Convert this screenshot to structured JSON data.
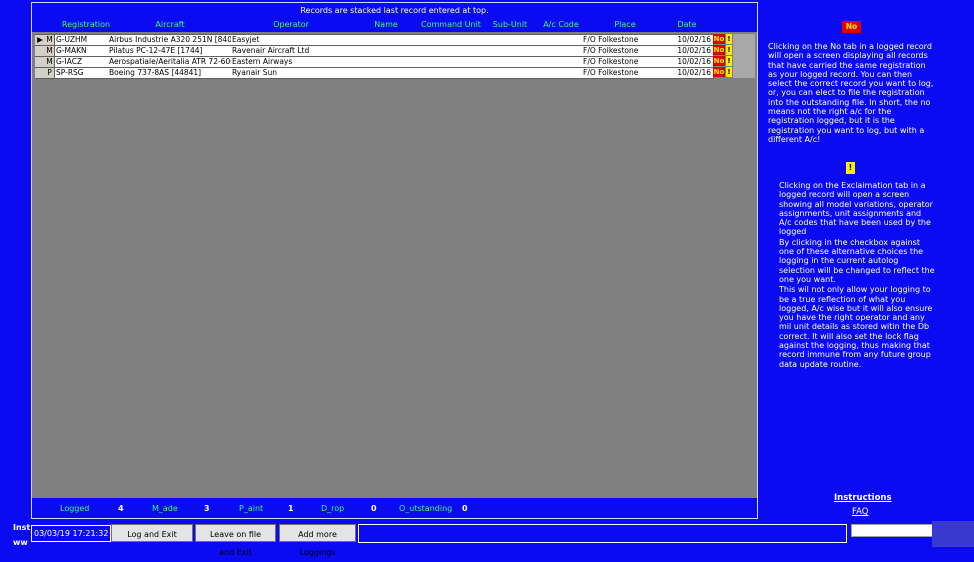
{
  "grid": {
    "caption": "Records are stacked last record entered at top.",
    "headers": {
      "registration": "Registration",
      "aircraft": "Aircraft",
      "operator": "Operator",
      "name": "Name",
      "command_unit": "Command Unit",
      "sub_unit": "Sub-Unit",
      "ac_code": "A/c Code",
      "place": "Place",
      "date": "Date"
    },
    "rows": [
      {
        "pointer": "▶",
        "type": "M",
        "registration": "G-UZHM",
        "aircraft": "Airbus Industrie A320 251N [8405]",
        "operator": "Easyjet",
        "name": "",
        "command_unit": "",
        "sub_unit": "",
        "ac_code": "",
        "place": "F/O Folkestone",
        "date": "10/02/16",
        "no": "No",
        "warn": "!"
      },
      {
        "pointer": "",
        "type": "M",
        "registration": "G-MAKN",
        "aircraft": "Pilatus PC-12-47E [1744]",
        "operator": "Ravenair Aircraft Ltd",
        "name": "",
        "command_unit": "",
        "sub_unit": "",
        "ac_code": "",
        "place": "F/O Folkestone",
        "date": "10/02/16",
        "no": "No",
        "warn": "!"
      },
      {
        "pointer": "",
        "type": "M",
        "registration": "G-IACZ",
        "aircraft": "Aerospatiale/Aeritalia ATR 72-600 [",
        "operator": "Eastern Airways",
        "name": "",
        "command_unit": "",
        "sub_unit": "",
        "ac_code": "",
        "place": "F/O Folkestone",
        "date": "10/02/16",
        "no": "No",
        "warn": "!"
      },
      {
        "pointer": "",
        "type": "P",
        "registration": "SP-RSG",
        "aircraft": "Boeing  737-8AS [44841]",
        "operator": "Ryanair Sun",
        "name": "",
        "command_unit": "",
        "sub_unit": "",
        "ac_code": "",
        "place": "F/O Folkestone",
        "date": "10/02/16",
        "no": "No",
        "warn": "!"
      }
    ]
  },
  "counts": {
    "logged_label": "Logged",
    "logged_value": "4",
    "made_label": "M_ade",
    "made_value": "3",
    "paint_label": "P_aint",
    "paint_value": "1",
    "drop_label": "D_rop",
    "drop_value": "0",
    "outstanding_label": "O_utstanding",
    "outstanding_value": "0"
  },
  "help": {
    "no_badge": "No",
    "no_text": "Clicking on the No tab in a logged record will open a screen displaying all records that have carried the same registration as your logged record. You can then select the correct record you want to log, or, you can elect to file the registration into the outstanding file. In short, the no means not the right a/c for the registration logged, but it is the registration you want to log, but with a different A/c!",
    "warn_badge": "!",
    "warn_text_1": "Clicking on the Exclaimation tab in a logged record will open a screen showing all model variations, operator assignments, unit assignments and A/c codes that have been used by the logged",
    "warn_text_2": "By clicking in the checkbox against one of these alternative choices the logging in the current autolog selection will be changed to reflect the one you want.",
    "warn_text_3": "This wil not only allow your logging to be a true reflection of what you logged, A/c wise but it will also ensure you have the right operator and any mil unit details as stored witin the Db correct. It will also set the lock flag against the logging, thus making that record immune from any future group data update routine.",
    "instructions_link": "Instructions",
    "faq_link": "FAQ"
  },
  "footer": {
    "left_fragment_1": "Inst",
    "left_fragment_2": "ww",
    "datetime": "03/03/19 17:21:32",
    "log_exit_label": "Log and Exit",
    "leave_file_label": "Leave on file and Exit",
    "add_more_label": "Add more Loggings"
  },
  "colors": {
    "background": "#0b0bf2",
    "header_text": "#33ff66",
    "no_button": "#e00000",
    "warn_button": "#ffee00",
    "grid_background": "#808080"
  }
}
